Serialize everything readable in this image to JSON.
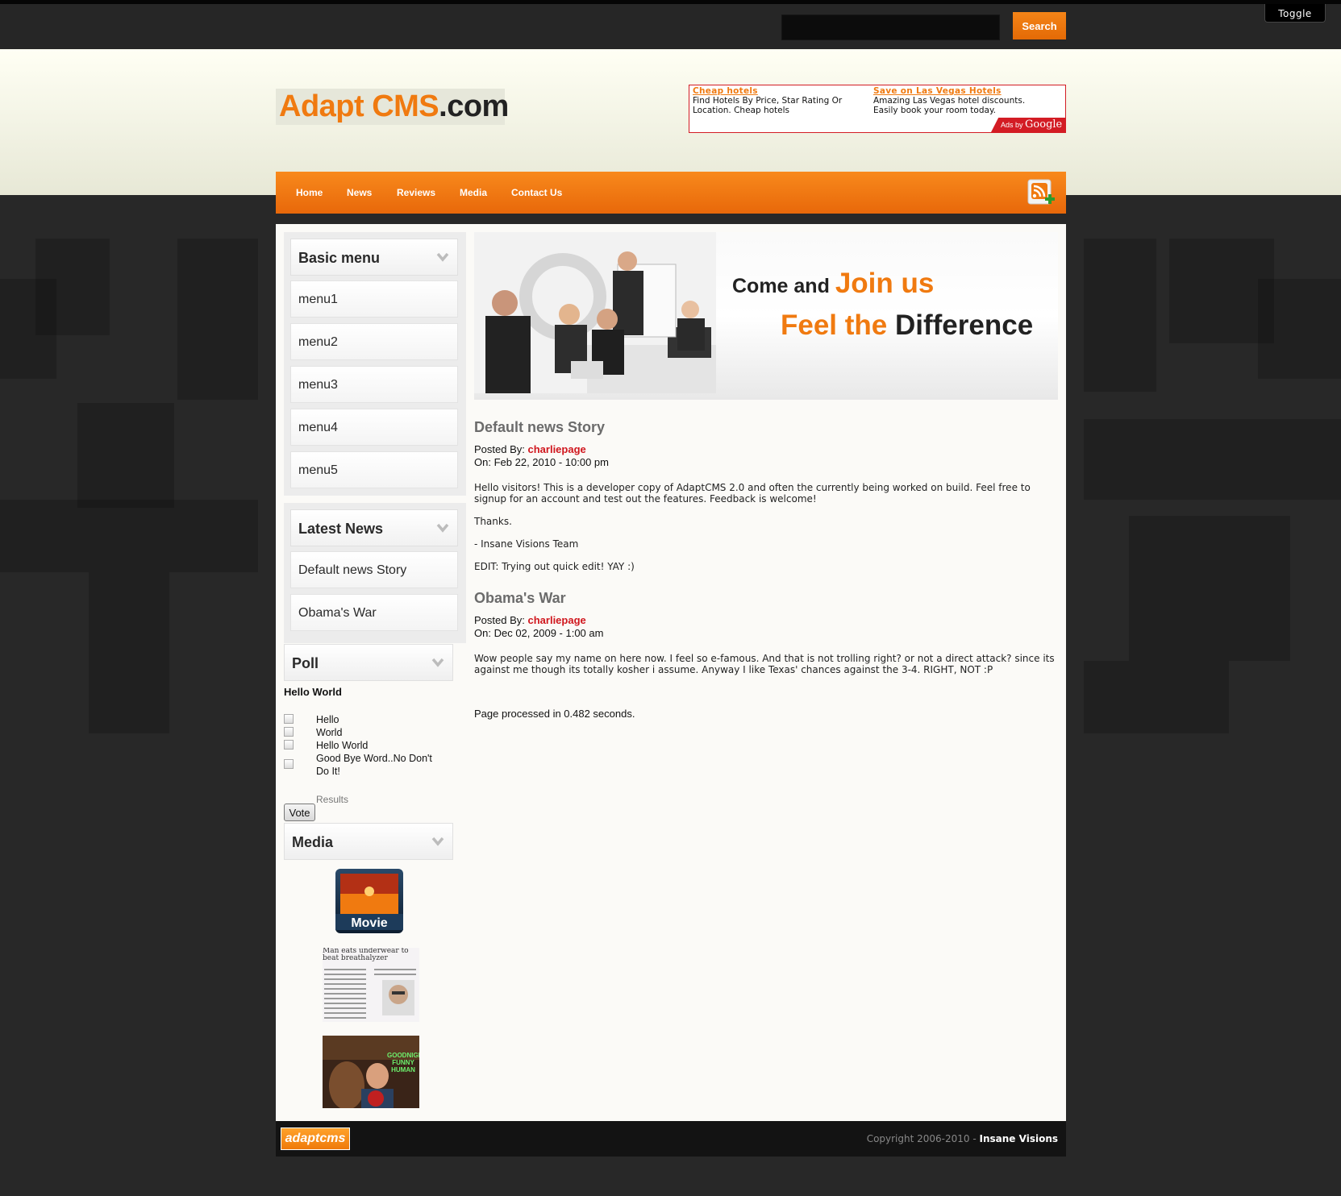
{
  "topbar": {
    "search_placeholder": "",
    "search_label": "Search",
    "toggle_label": "Toggle"
  },
  "header": {
    "logo_brand": "Adapt CMS",
    "logo_tld": ".com",
    "ads": [
      {
        "title": "Cheap hotels",
        "text": "Find Hotels By Price, Star Rating Or Location. Cheap hotels"
      },
      {
        "title": "Save on Las Vegas Hotels",
        "text": "Amazing Las Vegas hotel discounts. Easily book your room today."
      }
    ],
    "ads_by_prefix": "Ads by",
    "ads_by_brand": "Google"
  },
  "nav": {
    "items": [
      "Home",
      "News",
      "Reviews",
      "Media",
      "Contact Us"
    ]
  },
  "sidebar": {
    "basic_menu": {
      "title": "Basic menu",
      "items": [
        "menu1",
        "menu2",
        "menu3",
        "menu4",
        "menu5"
      ]
    },
    "latest_news": {
      "title": "Latest News",
      "items": [
        "Default news Story",
        "Obama's War"
      ]
    },
    "poll": {
      "title": "Poll",
      "question": "Hello World",
      "options": [
        "Hello",
        "World",
        "Hello World",
        "Good Bye Word..No Don't Do It!"
      ],
      "results_label": "Results",
      "vote_label": "Vote"
    },
    "media": {
      "title": "Media",
      "movie_label": "Movie",
      "newspaper_headline": "Man eats underwear to beat breathalyzer",
      "tv_caption": "GOODNIGHT FUNNY HUMAN"
    }
  },
  "banner": {
    "line1_prefix": "Come and",
    "line1_highlight": "Join us",
    "line2_highlight": "Feel the",
    "line2_suffix": "Difference"
  },
  "stories": [
    {
      "title": "Default news Story",
      "posted_by_label": "Posted By:",
      "author": "charliepage",
      "date_label": "On:",
      "date": "Feb 22, 2010 - 10:00 pm",
      "paragraphs": [
        "Hello visitors! This is a developer copy of AdaptCMS 2.0 and often the currently being worked on build. Feel free to signup for an account and test out the features. Feedback is welcome!",
        "Thanks.",
        "- Insane Visions Team",
        "EDIT: Trying out quick edit! YAY :)"
      ]
    },
    {
      "title": "Obama's War",
      "posted_by_label": "Posted By:",
      "author": "charliepage",
      "date_label": "On:",
      "date": "Dec 02, 2009 - 1:00 am",
      "paragraphs": [
        "Wow people say my name on here now. I feel so e-famous. And that is not trolling right? or not a direct attack? since its against me though its totally kosher i assume. Anyway I like Texas' chances against the 3-4. RIGHT, NOT :P"
      ]
    }
  ],
  "page_processed": "Page processed in 0.482 seconds.",
  "footer": {
    "logo": "adaptcms",
    "copyright_prefix": "Copyright 2006-2010 - ",
    "copyright_owner": "Insane Visions"
  },
  "colors": {
    "accent": "#f07a10",
    "author": "#d0161d",
    "background": "#282828",
    "content": "#fbfaf7"
  }
}
